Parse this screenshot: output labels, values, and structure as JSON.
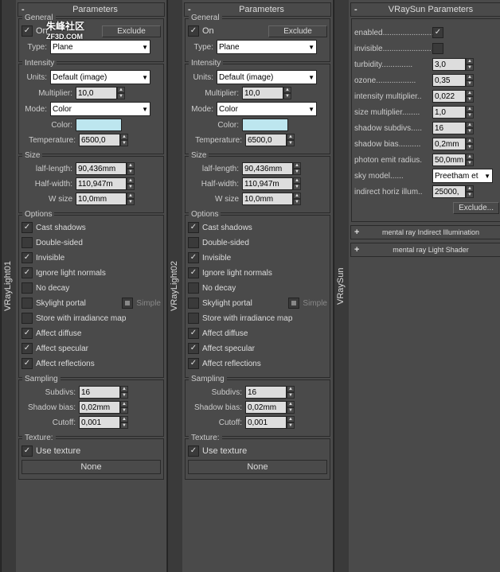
{
  "cols": [
    {
      "title": "VRayLight01"
    },
    {
      "title": "VRayLight02"
    },
    {
      "title": "VRaySun"
    }
  ],
  "params": {
    "rollup_title": "Parameters",
    "general": {
      "legend": "General",
      "on": "On",
      "exclude": "Exclude",
      "type_lab": "Type:",
      "type_val": "Plane"
    },
    "intensity": {
      "legend": "Intensity",
      "units_lab": "Units:",
      "units_val": "Default (image)",
      "mult_lab": "Multiplier:",
      "mult_val": "10,0",
      "mode_lab": "Mode:",
      "mode_val": "Color",
      "color_lab": "Color:",
      "temp_lab": "Temperature:",
      "temp_val": "6500,0"
    },
    "size": {
      "legend": "Size",
      "hl_lab": "lalf-length:",
      "hl_val": "90,436mm",
      "hw_lab": "Half-width:",
      "hw_val": "110,947m",
      "w_lab": "W size",
      "w_val": "10,0mm"
    },
    "options": {
      "legend": "Options",
      "items": [
        {
          "label": "Cast shadows",
          "checked": true
        },
        {
          "label": "Double-sided",
          "checked": false
        },
        {
          "label": "Invisible",
          "checked": true
        },
        {
          "label": "Ignore light normals",
          "checked": true
        },
        {
          "label": "No decay",
          "checked": false
        },
        {
          "label": "Skylight portal",
          "checked": false,
          "extra": "Simple"
        },
        {
          "label": "Store with irradiance map",
          "checked": false
        },
        {
          "label": "Affect diffuse",
          "checked": true
        },
        {
          "label": "Affect specular",
          "checked": true
        },
        {
          "label": "Affect reflections",
          "checked": true
        }
      ]
    },
    "sampling": {
      "legend": "Sampling",
      "subdivs_lab": "Subdivs:",
      "subdivs_val": "16",
      "bias_lab": "Shadow bias:",
      "bias_val": "0,02mm",
      "cutoff_lab": "Cutoff:",
      "cutoff_val": "0,001"
    },
    "texture": {
      "legend": "Texture:",
      "use": "Use texture",
      "none": "None"
    }
  },
  "sun": {
    "rollup_title": "VRaySun Parameters",
    "rows": [
      {
        "label": "enabled",
        "dots": ".......................",
        "type": "chk",
        "val": true
      },
      {
        "label": "invisible",
        "dots": "......................",
        "type": "chk",
        "val": false
      },
      {
        "label": "turbidity",
        "dots": "..............",
        "type": "spin",
        "val": "3,0"
      },
      {
        "label": "ozone",
        "dots": "..................",
        "type": "spin",
        "val": "0,35"
      },
      {
        "label": "intensity multiplier",
        "dots": "..",
        "type": "spin",
        "val": "0,022"
      },
      {
        "label": "size multiplier",
        "dots": "........",
        "type": "spin",
        "val": "1,0"
      },
      {
        "label": "shadow subdivs",
        "dots": ".....",
        "type": "spin",
        "val": "16"
      },
      {
        "label": "shadow bias",
        "dots": "..........",
        "type": "spin",
        "val": "0,2mm"
      },
      {
        "label": "photon emit radius",
        "dots": ".",
        "type": "spin",
        "val": "50,0mm"
      },
      {
        "label": "sky model",
        "dots": "......",
        "type": "sel",
        "val": "Preetham et"
      },
      {
        "label": "indirect horiz illum",
        "dots": "..",
        "type": "spin",
        "val": "25000,"
      }
    ],
    "exclude": "Exclude...",
    "extra_rollups": [
      {
        "pm": "+",
        "title": "mental ray Indirect Illumination"
      },
      {
        "pm": "+",
        "title": "mental ray Light Shader"
      }
    ]
  },
  "watermark": {
    "top": "朱峰社区",
    "bottom": "ZF3D.COM"
  }
}
